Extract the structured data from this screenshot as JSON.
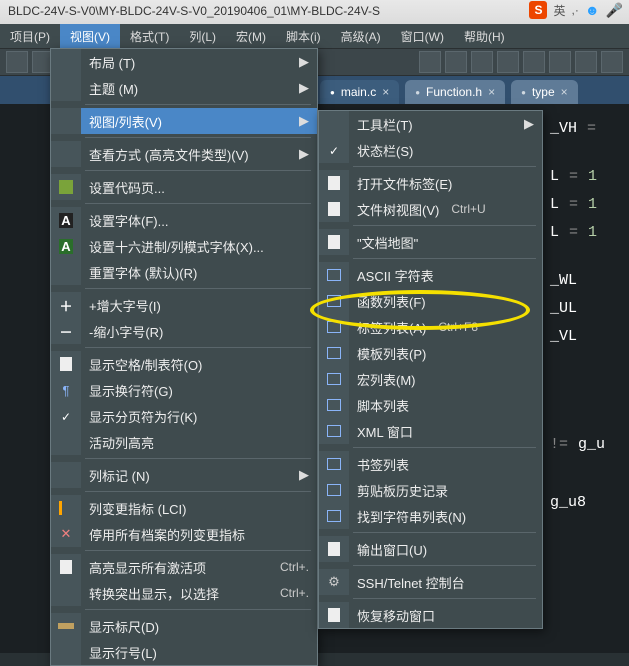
{
  "titlebar": "BLDC-24V-S-V0\\MY-BLDC-24V-S-V0_20190406_01\\MY-BLDC-24V-S",
  "ime": {
    "logo": "S",
    "lang": "英",
    "comma": ",·"
  },
  "menubar": [
    {
      "label": "项目(P)"
    },
    {
      "label": "视图(V)",
      "open": true
    },
    {
      "label": "格式(T)"
    },
    {
      "label": "列(L)"
    },
    {
      "label": "宏(M)"
    },
    {
      "label": "脚本(i)"
    },
    {
      "label": "高级(A)"
    },
    {
      "label": "窗口(W)"
    },
    {
      "label": "帮助(H)"
    }
  ],
  "tabs": [
    {
      "label": "main.c",
      "active": true
    },
    {
      "label": "Function.h",
      "active": false
    },
    {
      "label": "type",
      "active": false
    }
  ],
  "menu": [
    {
      "label": "布局 (T)",
      "arrow": true
    },
    {
      "label": "主题 (M)",
      "arrow": true
    },
    {
      "sep": true
    },
    {
      "label": "视图/列表(V)",
      "arrow": true,
      "hl": true
    },
    {
      "sep": true
    },
    {
      "label": "查看方式 (高亮文件类型)(V)",
      "arrow": true
    },
    {
      "sep": true
    },
    {
      "label": "设置代码页...",
      "icon": "sq"
    },
    {
      "sep": true
    },
    {
      "label": "设置字体(F)...",
      "icon": "A"
    },
    {
      "label": "设置十六进制/列模式字体(X)...",
      "icon": "Ag"
    },
    {
      "label": "重置字体 (默认)(R)"
    },
    {
      "sep": true
    },
    {
      "label": "+增大字号(I)",
      "icon": "plus"
    },
    {
      "label": "-缩小字号(R)",
      "icon": "minus"
    },
    {
      "sep": true
    },
    {
      "label": "显示空格/制表符(O)",
      "icon": "doc"
    },
    {
      "label": "显示换行符(G)",
      "icon": "para"
    },
    {
      "label": "显示分页符为行(K)",
      "icon": "chk"
    },
    {
      "label": "活动列高亮"
    },
    {
      "sep": true
    },
    {
      "label": "列标记 (N)",
      "arrow": true
    },
    {
      "sep": true
    },
    {
      "label": "列变更指标 (LCI)",
      "icon": "lci"
    },
    {
      "label": "停用所有档案的列变更指标",
      "icon": "x"
    },
    {
      "sep": true
    },
    {
      "label": "高亮显示所有激活项",
      "shortcut": "Ctrl+.",
      "icon": "doc"
    },
    {
      "label": "转换突出显示，以选择",
      "shortcut": "Ctrl+."
    },
    {
      "sep": true
    },
    {
      "label": "显示标尺(D)",
      "icon": "ruler"
    },
    {
      "label": "显示行号(L)"
    }
  ],
  "submenu": [
    {
      "label": "工具栏(T)",
      "arrow": true
    },
    {
      "label": "状态栏(S)",
      "icon": "chk"
    },
    {
      "sep": true
    },
    {
      "label": "打开文件标签(E)",
      "icon": "doc"
    },
    {
      "label": "文件树视图(V)",
      "shortcut": "Ctrl+U",
      "icon": "doc"
    },
    {
      "sep": true
    },
    {
      "label": "\"文档地图\"",
      "icon": "doc"
    },
    {
      "sep": true
    },
    {
      "label": "ASCII 字符表",
      "icon": "list"
    },
    {
      "label": "函数列表(F)",
      "icon": "list",
      "emph": true
    },
    {
      "label": "标签列表(A)",
      "shortcut": "Ctrl+F8",
      "icon": "list"
    },
    {
      "label": "模板列表(P)",
      "icon": "list"
    },
    {
      "label": "宏列表(M)",
      "icon": "list"
    },
    {
      "label": "脚本列表",
      "icon": "list"
    },
    {
      "label": "XML 窗口",
      "icon": "list"
    },
    {
      "sep": true
    },
    {
      "label": "书签列表",
      "icon": "list"
    },
    {
      "label": "剪贴板历史记录",
      "icon": "list"
    },
    {
      "label": "找到字符串列表(N)",
      "icon": "list"
    },
    {
      "sep": true
    },
    {
      "label": "输出窗口(U)",
      "icon": "doc"
    },
    {
      "sep": true
    },
    {
      "label": "SSH/Telnet 控制台",
      "icon": "gear"
    },
    {
      "sep": true
    },
    {
      "label": "恢复移动窗口",
      "icon": "doc"
    }
  ],
  "code": {
    "l1": "_VH",
    "l2": "L",
    "v2": "1",
    "l3": "L",
    "v3": "1",
    "l4": "L",
    "v4": "1",
    "l5": "_WL",
    "l6": "_UL",
    "l7": "_VL",
    "l8": "!=",
    "i8": "g_u",
    "l9": "",
    "i9": "g_u8"
  }
}
